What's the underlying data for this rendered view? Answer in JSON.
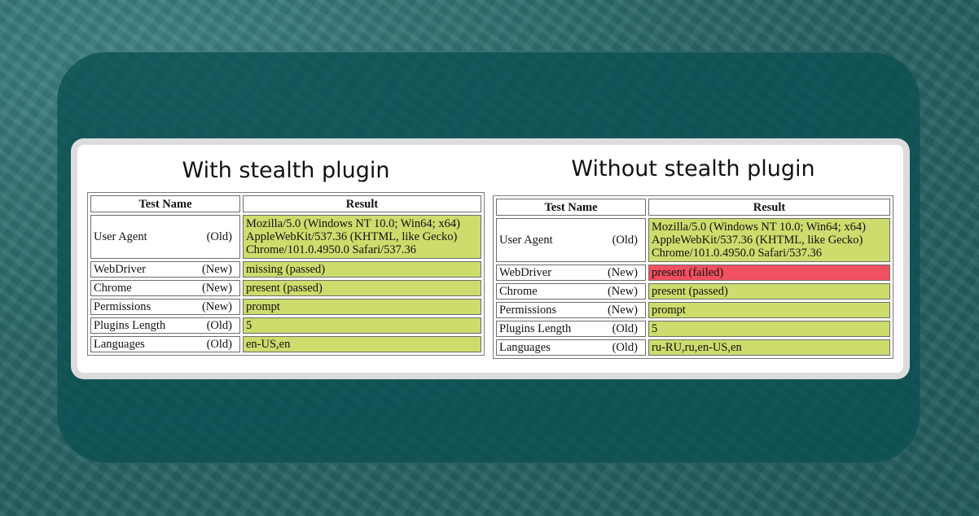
{
  "colors": {
    "passed": "#cddc6c",
    "failed": "#f05060",
    "frame": "#0a5052",
    "background": "#2e6b6c"
  },
  "headers": {
    "test_name": "Test Name",
    "result": "Result"
  },
  "left": {
    "title": "With stealth plugin",
    "rows": [
      {
        "name": "User Agent",
        "tag": "(Old)",
        "result": "Mozilla/5.0 (Windows NT 10.0; Win64; x64) AppleWebKit/537.36 (KHTML, like Gecko) Chrome/101.0.4950.0 Safari/537.36"
      },
      {
        "name": "WebDriver",
        "tag": "(New)",
        "result": "missing (passed)"
      },
      {
        "name": "Chrome",
        "tag": "(New)",
        "result": "present (passed)"
      },
      {
        "name": "Permissions",
        "tag": "(New)",
        "result": "prompt"
      },
      {
        "name": "Plugins Length",
        "tag": "(Old)",
        "result": "5"
      },
      {
        "name": "Languages",
        "tag": "(Old)",
        "result": "en-US,en"
      }
    ]
  },
  "right": {
    "title": "Without stealth plugin",
    "rows": [
      {
        "name": "User Agent",
        "tag": "(Old)",
        "result": "Mozilla/5.0 (Windows NT 10.0; Win64; x64) AppleWebKit/537.36 (KHTML, like Gecko) Chrome/101.0.4950.0 Safari/537.36"
      },
      {
        "name": "WebDriver",
        "tag": "(New)",
        "result": "present (failed)"
      },
      {
        "name": "Chrome",
        "tag": "(New)",
        "result": "present (passed)"
      },
      {
        "name": "Permissions",
        "tag": "(New)",
        "result": "prompt"
      },
      {
        "name": "Plugins Length",
        "tag": "(Old)",
        "result": "5"
      },
      {
        "name": "Languages",
        "tag": "(Old)",
        "result": "ru-RU,ru,en-US,en"
      }
    ]
  }
}
